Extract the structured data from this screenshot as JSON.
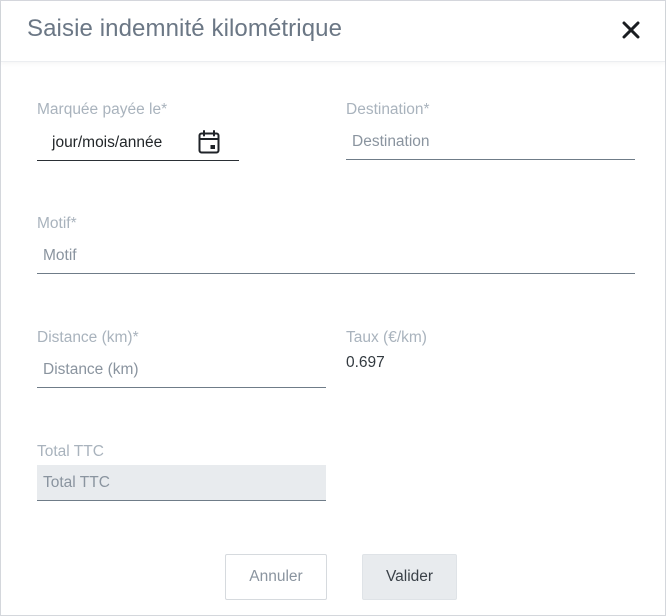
{
  "modal": {
    "title": "Saisie indemnité kilométrique"
  },
  "fields": {
    "paid_date": {
      "label": "Marquée payée le*",
      "value": "jour/mois/année"
    },
    "destination": {
      "label": "Destination*",
      "placeholder": "Destination"
    },
    "motif": {
      "label": "Motif*",
      "placeholder": "Motif"
    },
    "distance": {
      "label": "Distance (km)*",
      "placeholder": "Distance (km)"
    },
    "taux": {
      "label": "Taux (€/km)",
      "value": "0.697"
    },
    "total": {
      "label": "Total TTC",
      "placeholder": "Total TTC"
    }
  },
  "buttons": {
    "cancel_label": "Annuler",
    "submit_label": "Valider"
  },
  "icons": {
    "close": "close-icon",
    "calendar": "calendar-icon"
  }
}
